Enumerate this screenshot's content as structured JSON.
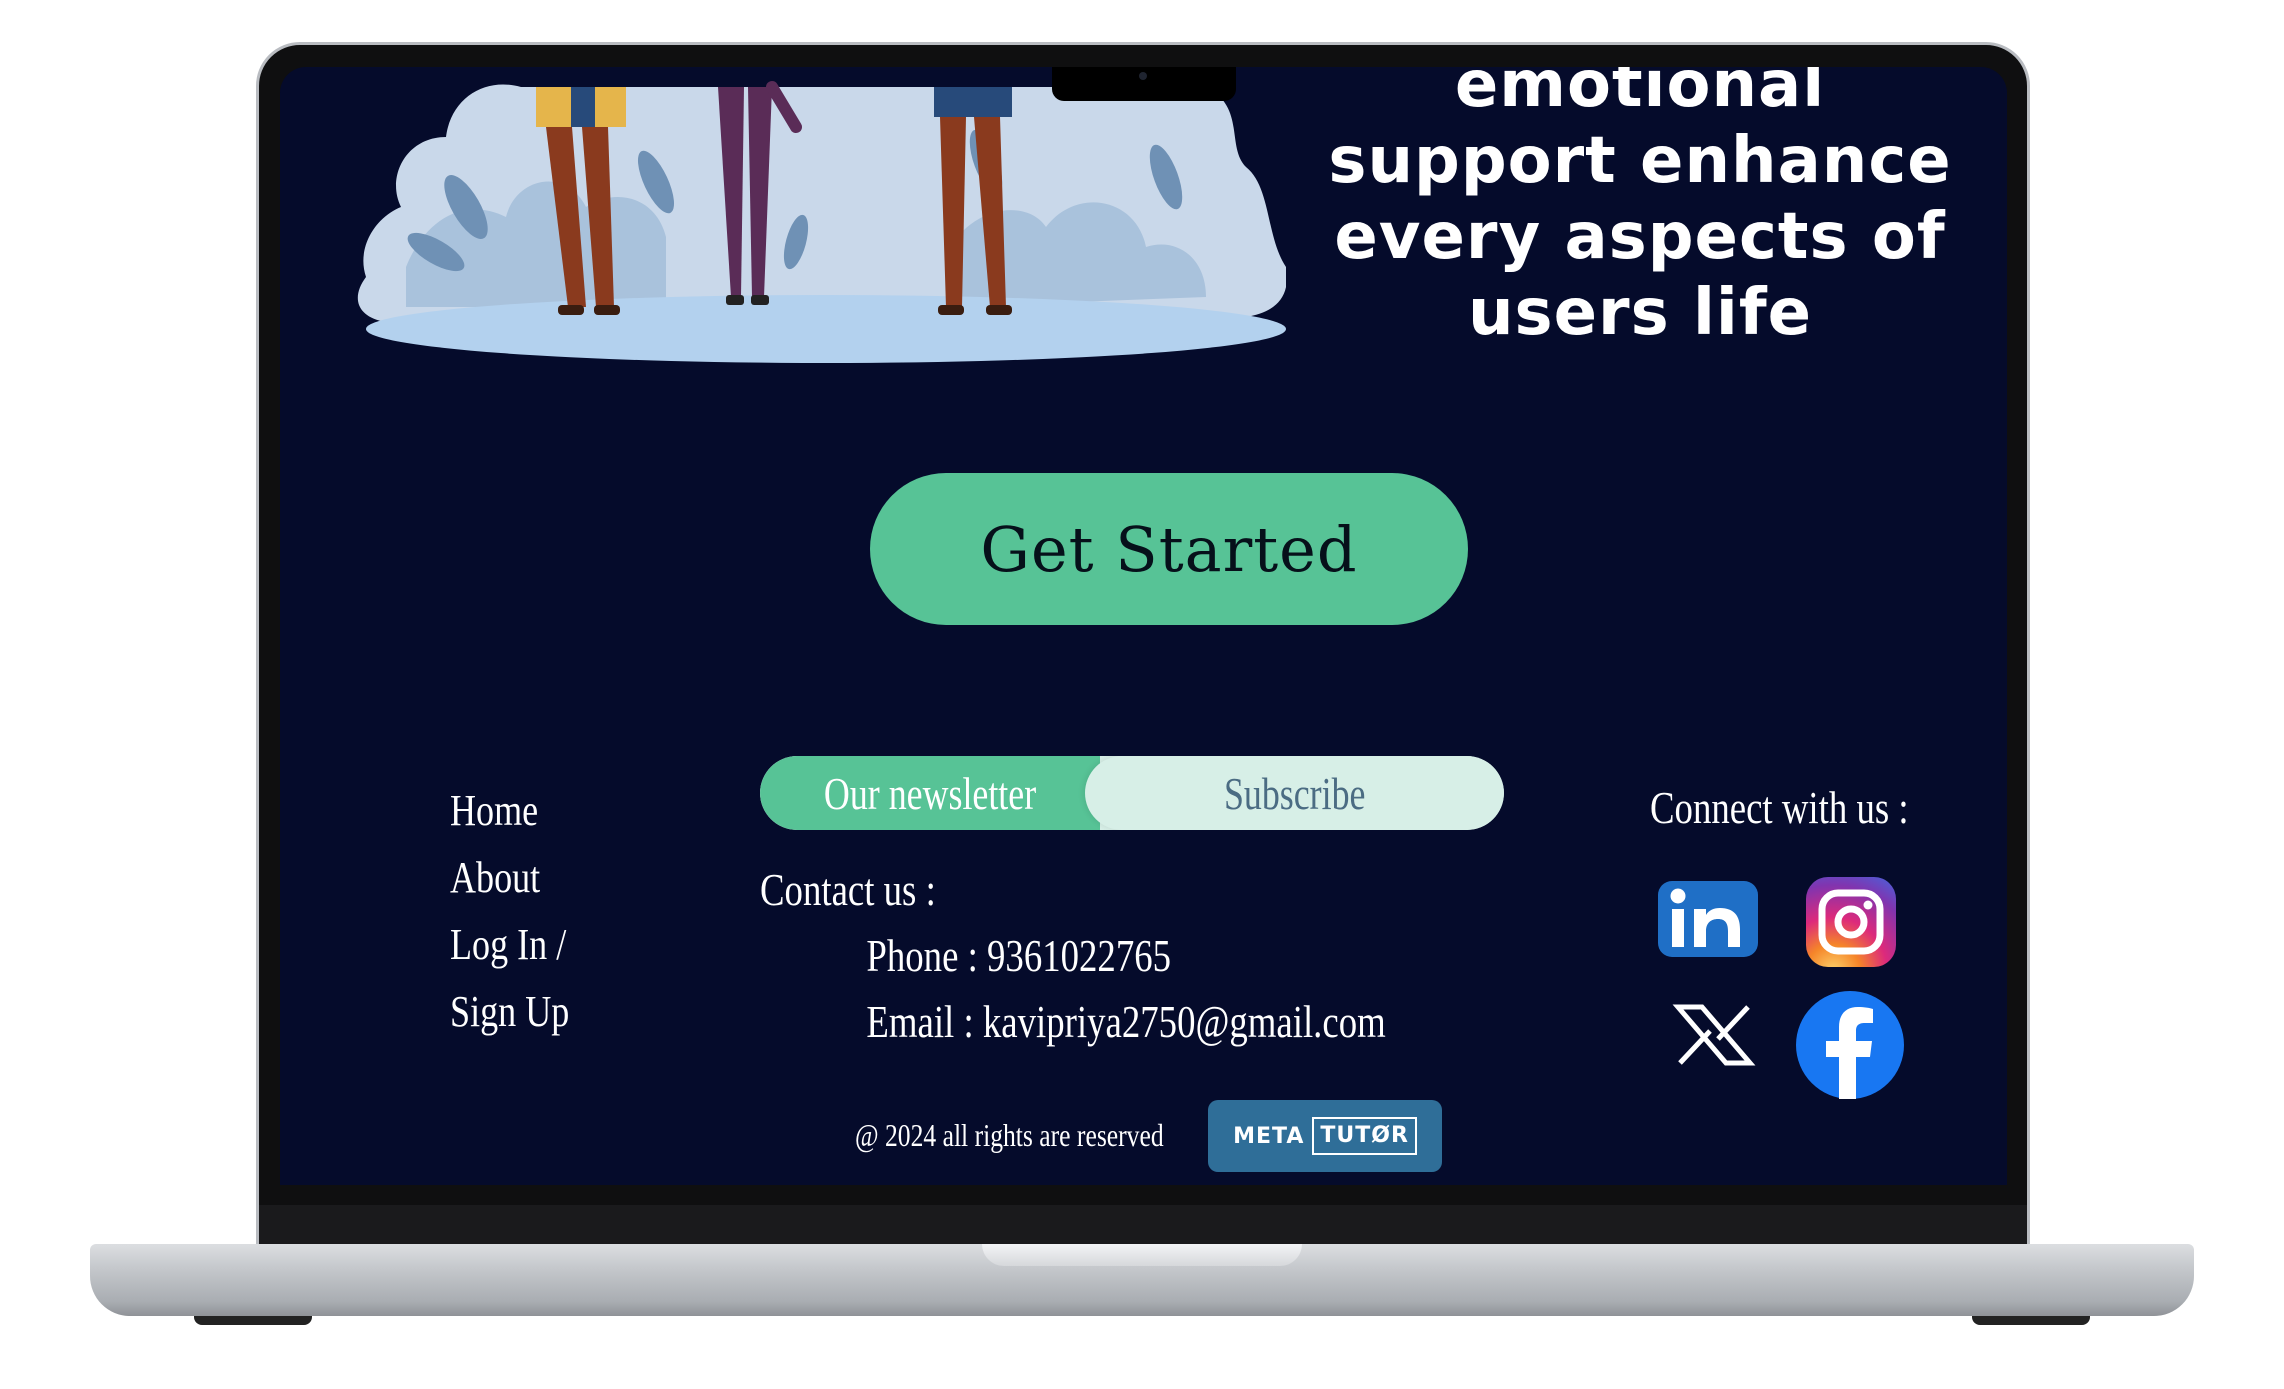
{
  "hero": {
    "lines": [
      "emotional",
      "support enhance",
      "every aspects of",
      "users life"
    ]
  },
  "cta": {
    "label": "Get Started"
  },
  "footer_nav": {
    "items": [
      "Home",
      "About",
      "Log In /",
      "Sign Up"
    ]
  },
  "newsletter": {
    "label": "Our newsletter",
    "button": "Subscribe"
  },
  "contact": {
    "heading": "Contact us :",
    "phone": "Phone : 9361022765",
    "email": "Email : kavipriya2750@gmail.com"
  },
  "copyright": "@ 2024 all rights are reserved",
  "brand": {
    "part1": "META",
    "part2": "TUTØR"
  },
  "social": {
    "heading": "Connect with us :",
    "icons": [
      "linkedin-icon",
      "instagram-icon",
      "x-icon",
      "facebook-icon"
    ]
  },
  "colors": {
    "background": "#050b2b",
    "accent": "#57c396",
    "subscribe_bg": "#d7efe7",
    "brand_badge": "#2f6e98"
  }
}
